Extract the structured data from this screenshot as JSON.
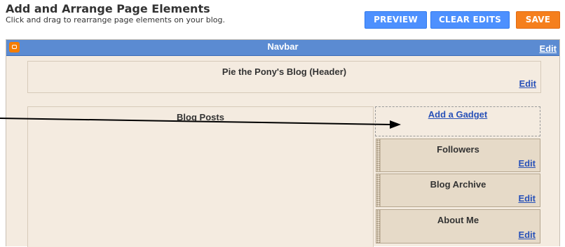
{
  "header": {
    "title": "Add and Arrange Page Elements",
    "subtitle": "Click and drag to rearrange page elements on your blog."
  },
  "buttons": {
    "preview": "PREVIEW",
    "clear_edits": "CLEAR EDITS",
    "save": "SAVE"
  },
  "navbar": {
    "title": "Navbar",
    "edit": "Edit"
  },
  "header_section": {
    "title": "Pie the Pony's Blog (Header)",
    "edit": "Edit"
  },
  "blog_posts": {
    "title": "Blog Posts"
  },
  "sidebar": {
    "add_gadget": "Add a Gadget",
    "gadgets": [
      {
        "title": "Followers",
        "edit": "Edit"
      },
      {
        "title": "Blog Archive",
        "edit": "Edit"
      },
      {
        "title": "About Me",
        "edit": "Edit"
      }
    ]
  },
  "colors": {
    "accent_blue": "#4d90fe",
    "save_orange": "#f57f1d",
    "navbar_blue": "#5b8bd2",
    "layout_background": "#f4ebe0",
    "gadget_background": "#e6dac8",
    "link_blue": "#2851b8"
  },
  "icons": {
    "navbar_logo": "blogger-logo-icon",
    "annotation": "arrow-annotation"
  }
}
